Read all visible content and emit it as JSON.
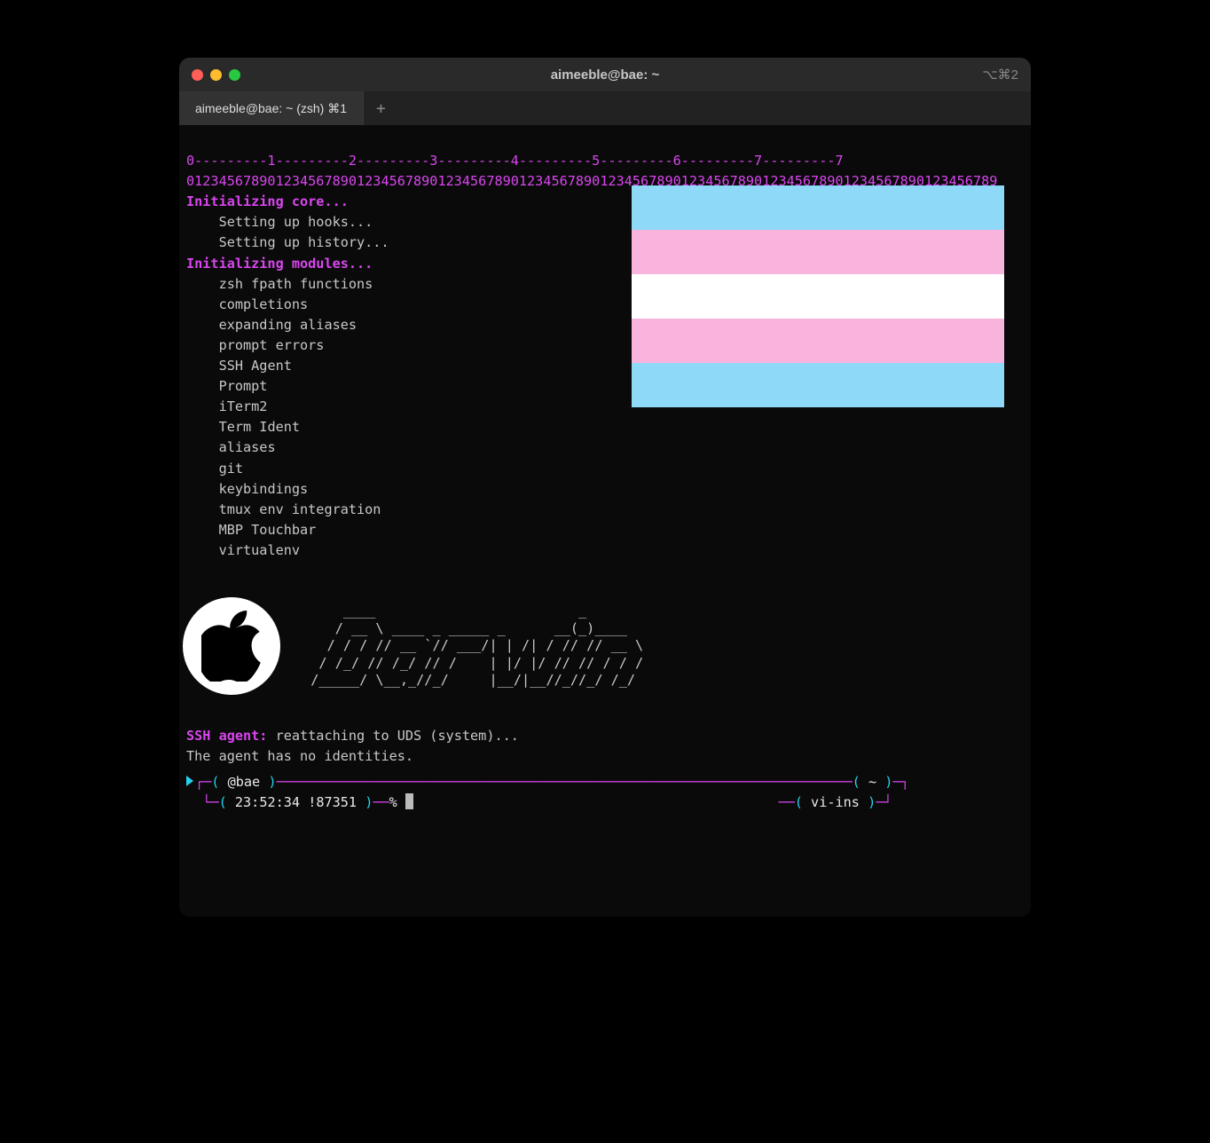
{
  "titlebar": {
    "title": "aimeeble@bae: ~",
    "shortcut": "⌥⌘2"
  },
  "tabs": {
    "active": "aimeeble@bae: ~ (zsh)  ⌘1",
    "new_label": "+"
  },
  "ruler": {
    "line1": "0---------1---------2---------3---------4---------5---------6---------7---------7",
    "line2": "0123456789012345678901234567890123456789012345678901234567890123456789012345678901234567890123456789"
  },
  "init": {
    "core": "Initializing core...",
    "core_steps": [
      "Setting up hooks...",
      "Setting up history..."
    ],
    "modules": "Initializing modules...",
    "module_list": [
      "zsh fpath functions",
      "completions",
      "expanding aliases",
      "prompt errors",
      "SSH Agent",
      "Prompt",
      "iTerm2",
      "Term Ident",
      "aliases",
      "git",
      "keybindings",
      "tmux env integration",
      "MBP Touchbar",
      "virtualenv"
    ]
  },
  "flag": {
    "name": "transgender-pride-flag",
    "colors": [
      "#8ed8f8",
      "#f8b4dc",
      "#ffffff",
      "#f8b4dc",
      "#8ed8f8"
    ]
  },
  "ascii": {
    "line1": "      ____                         _       ",
    "line2": "     / __ \\ ____ _ _____ _      __(_)____  ",
    "line3": "    / / / // __ `// ___/| | /| / // // __ \\",
    "line4": "   / /_/ // /_/ // /    | |/ |/ // // / / /",
    "line5": "  /_____/ \\__,_//_/     |__/|__//_//_/ /_/ "
  },
  "ssh": {
    "label": "SSH agent:",
    "msg": " reattaching to UDS (system)...",
    "no_identities": "The agent has no identities."
  },
  "prompt": {
    "host": "@bae",
    "cwd": "~",
    "time": "23:52:34",
    "hist": "!87351",
    "symbol": "%",
    "mode": "vi-ins"
  }
}
